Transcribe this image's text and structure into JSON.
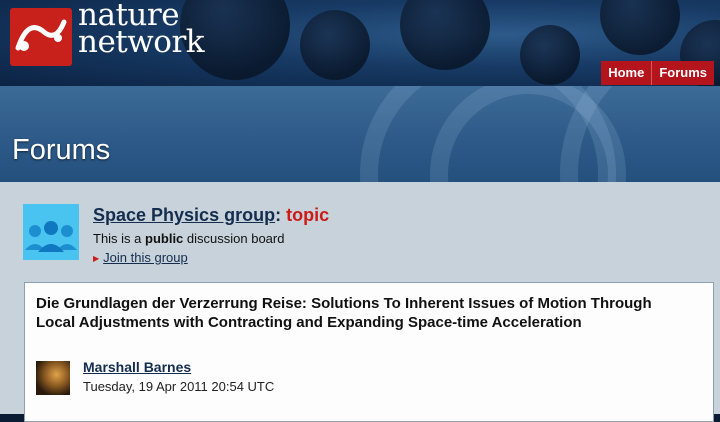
{
  "logo": {
    "line1": "nature",
    "line2": "network"
  },
  "topnav": {
    "home": "Home",
    "forums": "Forums"
  },
  "banner": {
    "title": "Forums"
  },
  "group": {
    "name": "Space Physics group",
    "separator": ":",
    "topic": "topic",
    "desc_prefix": "This is a ",
    "desc_bold": "public",
    "desc_suffix": " discussion board",
    "join_label": "Join this group"
  },
  "post": {
    "title": "Die Grundlagen der Verzerrung Reise: Solutions To Inherent Issues of Motion Through Local Adjustments with Contracting and Expanding Space-time Acceleration",
    "author": "Marshall Barnes",
    "date": "Tuesday, 19 Apr 2011 20:54 UTC"
  },
  "colors": {
    "accent_red": "#cc1a16",
    "nav_red": "#b4141c",
    "group_icon_blue": "#49c3f0",
    "link_navy": "#142d4f"
  }
}
